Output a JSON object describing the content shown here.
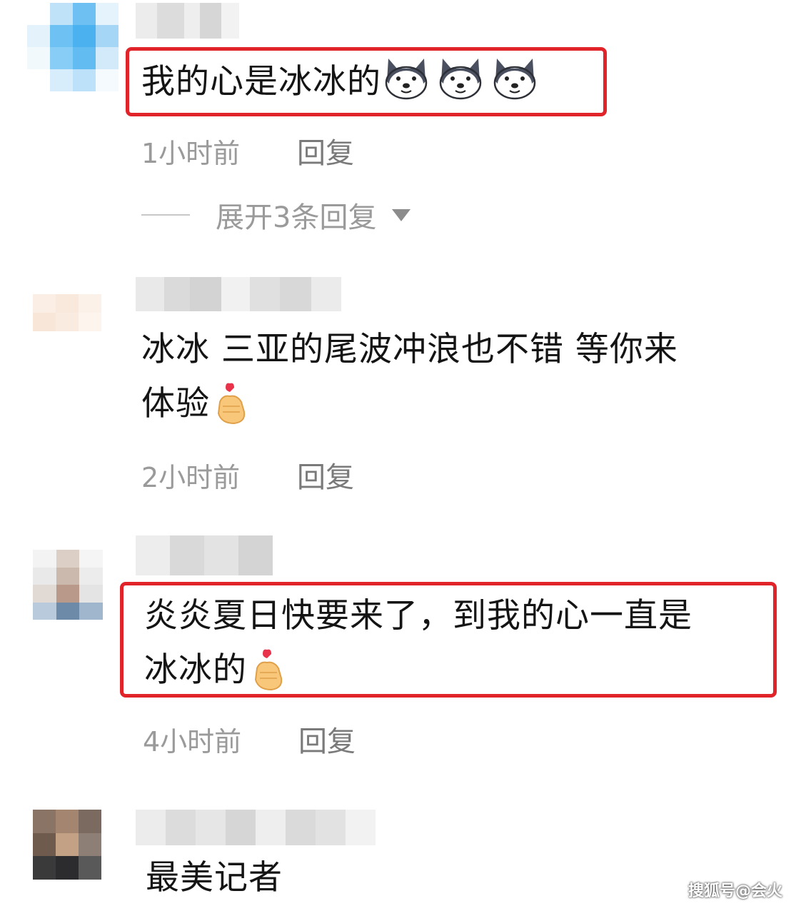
{
  "comments": [
    {
      "text_before": "我的心是冰冰的",
      "emoji_count": 3,
      "time": "1小时前",
      "reply_label": "回复",
      "expand_label": "展开3条回复"
    },
    {
      "line1": "冰冰 三亚的尾波冲浪也不错 等你来",
      "line2": "体验",
      "time": "2小时前",
      "reply_label": "回复"
    },
    {
      "line1": "炎炎夏日快要来了，到我的心一直是",
      "line2": "冰冰的",
      "time": "4小时前",
      "reply_label": "回复"
    },
    {
      "text": "最美记者"
    }
  ],
  "watermark": "搜狐号@会火",
  "colors": {
    "highlight_border": "#e0242a",
    "comment_text": "#141414",
    "meta_text": "#9a9a9a"
  },
  "icons": {
    "dog_emoji": "husky-dog-icon",
    "hand_emoji": "finger-heart-icon",
    "expand_arrow": "triangle-down-icon"
  }
}
